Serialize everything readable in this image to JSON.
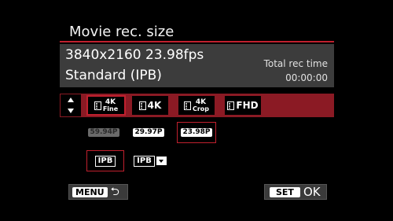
{
  "header": {
    "title": "Movie rec. size"
  },
  "info": {
    "resolution_fps": "3840x2160 23.98fps",
    "compression": "Standard (IPB)",
    "total_rec_time_label": "Total rec time",
    "total_rec_time_value": "00:00:00"
  },
  "sizes": [
    {
      "label": "4K",
      "sub": "Fine",
      "icon": "film-icon",
      "selected": true
    },
    {
      "label": "4K",
      "sub": "",
      "icon": "film-icon",
      "selected": false
    },
    {
      "label": "4K",
      "sub": "Crop",
      "icon": "film-icon",
      "selected": false
    },
    {
      "label": "FHD",
      "sub": "",
      "icon": "film-icon",
      "selected": false
    }
  ],
  "frame_rates": [
    {
      "label": "59.94P",
      "dimmed": true,
      "selected": false
    },
    {
      "label": "29.97P",
      "dimmed": false,
      "selected": false
    },
    {
      "label": "23.98P",
      "dimmed": false,
      "selected": true
    }
  ],
  "compression_opts": [
    {
      "label": "IPB",
      "icon": "",
      "selected": true
    },
    {
      "label": "IPB",
      "icon": "light-icon",
      "selected": false
    }
  ],
  "buttons": {
    "menu_tag": "MENU",
    "menu_icon": "return-arrow-icon",
    "set_tag": "SET",
    "ok_text": "OK"
  },
  "colors": {
    "accent": "#c0202e",
    "row_highlight": "#8b1a24",
    "panel": "#3c3c3c"
  }
}
